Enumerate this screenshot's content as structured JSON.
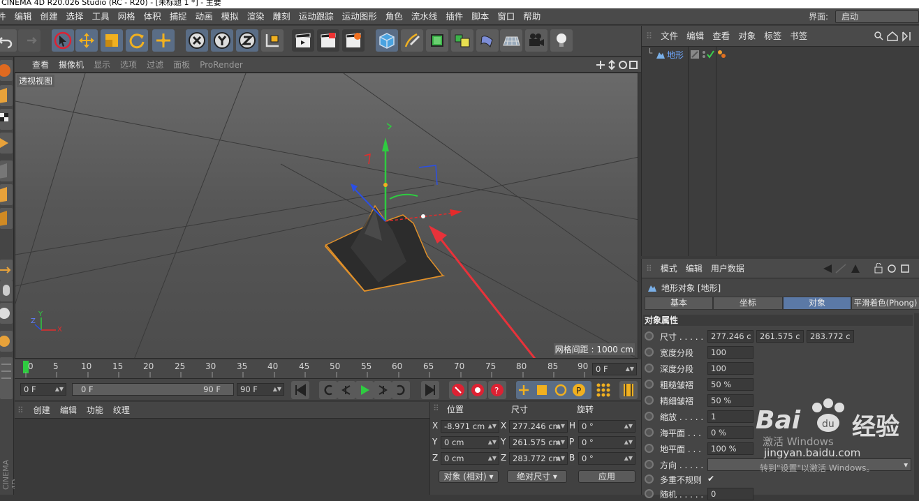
{
  "window": {
    "title": "CINEMA 4D R20.026 Studio (RC - R20) - [未标题 1 *] - 主要"
  },
  "menubar": {
    "items": [
      "件",
      "编辑",
      "创建",
      "选择",
      "工具",
      "网格",
      "体积",
      "捕捉",
      "动画",
      "模拟",
      "渲染",
      "雕刻",
      "运动跟踪",
      "运动图形",
      "角色",
      "流水线",
      "插件",
      "脚本",
      "窗口",
      "帮助"
    ],
    "layout_label": "界面:",
    "layout_value": "启动"
  },
  "viewport": {
    "menu": [
      "查看",
      "摄像机",
      "显示",
      "选项",
      "过滤",
      "面板",
      "ProRender"
    ],
    "label": "透视视图",
    "grid_spacing": "网格间距 : 1000 cm",
    "axis": {
      "x": "X",
      "y": "Y",
      "z": "Z"
    }
  },
  "timeline": {
    "ticks": [
      "0",
      "5",
      "10",
      "15",
      "20",
      "25",
      "30",
      "35",
      "40",
      "45",
      "50",
      "55",
      "60",
      "65",
      "70",
      "75",
      "80",
      "85",
      "90"
    ],
    "current_frame": "0 F"
  },
  "playbar": {
    "start": "0 F",
    "range_start": "0 F",
    "range_end": "90 F",
    "end": "90 F"
  },
  "material": {
    "menu": [
      "创建",
      "编辑",
      "功能",
      "纹理"
    ]
  },
  "coords": {
    "headers": [
      "位置",
      "尺寸",
      "旋转"
    ],
    "rows": [
      {
        "pl": "X",
        "pv": "-8.971 cm",
        "sl": "X",
        "sv": "277.246 cm",
        "rl": "H",
        "rv": "0 °"
      },
      {
        "pl": "Y",
        "pv": "0 cm",
        "sl": "Y",
        "sv": "261.575 cm",
        "rl": "P",
        "rv": "0 °"
      },
      {
        "pl": "Z",
        "pv": "0 cm",
        "sl": "Z",
        "sv": "283.772 cm",
        "rl": "B",
        "rv": "0 °"
      }
    ],
    "mode": "对象 (相对)",
    "size_mode": "绝对尺寸",
    "apply": "应用"
  },
  "objects": {
    "menu": [
      "文件",
      "编辑",
      "查看",
      "对象",
      "标签",
      "书签"
    ],
    "items": [
      {
        "name": "地形"
      }
    ]
  },
  "attributes": {
    "menu": [
      "模式",
      "编辑",
      "用户数据"
    ],
    "title": "地形对象 [地形]",
    "tabs": [
      "基本",
      "坐标",
      "对象",
      "平滑着色(Phong)"
    ],
    "section": "对象属性",
    "size_label": "尺寸 . . . . .",
    "size_values": [
      "277.246 c",
      "261.575 c",
      "283.772 c"
    ],
    "props": [
      {
        "label": "宽度分段",
        "value": "100"
      },
      {
        "label": "深度分段",
        "value": "100"
      },
      {
        "label": "粗糙皱褶",
        "value": "50 %"
      },
      {
        "label": "精细皱褶",
        "value": "50 %"
      },
      {
        "label": "缩放 . . . . .",
        "value": "1"
      },
      {
        "label": "海平面 . . .",
        "value": "0 %"
      },
      {
        "label": "地平面 . . .",
        "value": "100 %"
      },
      {
        "label": "方向 . . . . .",
        "value": ""
      },
      {
        "label": "多重不规则",
        "value": "✔"
      },
      {
        "label": "随机 . . . . .",
        "value": "0"
      }
    ]
  },
  "watermark": {
    "brand_a": "Bai",
    "brand_b": "经验",
    "url": "jingyan.baidu.com",
    "activate_1": "激活 Windows",
    "activate_2": "转到\"设置\"以激活 Windows。"
  },
  "colors": {
    "accent": "#5b79a6",
    "terrain_outline": "#e0902a",
    "arrow": "#e8323a"
  }
}
